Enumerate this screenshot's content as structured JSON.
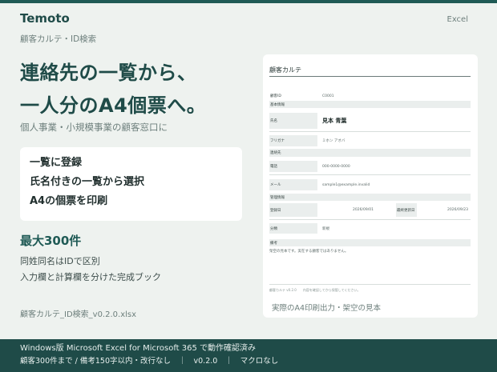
{
  "header": {
    "brand": "Temoto",
    "excel_tag": "Excel",
    "subtitle": "顧客カルテ・ID検索"
  },
  "hero": {
    "line1": "連絡先の一覧から、",
    "line2": "一人分のA4個票へ。",
    "tagline": "個人事業・小規模事業の顧客窓口に"
  },
  "features": [
    "一覧に登録",
    "氏名付きの一覧から選択",
    "A4の個票を印刷"
  ],
  "stats": {
    "max_count": "最大300件",
    "note1": "同姓同名はIDで区別",
    "note2": "入力欄と計算欄を分けた完成ブック"
  },
  "file": {
    "filename": "顧客カルテ_ID検索_v0.2.0.xlsx"
  },
  "preview": {
    "title": "顧客カルテ",
    "id_label": "顧客ID",
    "id_value": "C0001",
    "section_basic": "基本情報",
    "name_label": "氏名",
    "name_value": "見本 青葉",
    "kana_label": "フリガナ",
    "kana_value": "ミホン アオバ",
    "section_contact": "連絡先",
    "phone_label": "電話",
    "phone_value": "000-0000-0000",
    "mail_label": "メール",
    "mail_value": "sample1@example.invalid",
    "section_mgmt": "管理情報",
    "reg_label": "登録日",
    "reg_value": "2026/09/01",
    "upd_label": "最終更新日",
    "upd_value": "2026/09/23",
    "cat_label": "分類",
    "cat_value": "新規",
    "memo_label": "備考",
    "memo_value": "架空の見本です。実在する顧客ではありません。",
    "footer_note": "顧客カルテ v0.2.0　　内容を確認してから保管してください。",
    "caption": "実際のA4印刷出力・架空の見本"
  },
  "footer": {
    "line1": "Windows版 Microsoft Excel for Microsoft 365 で動作確認済み",
    "line2": "顧客300件まで / 備考150字以内・改行なし　｜　v0.2.0　｜　マクロなし"
  }
}
